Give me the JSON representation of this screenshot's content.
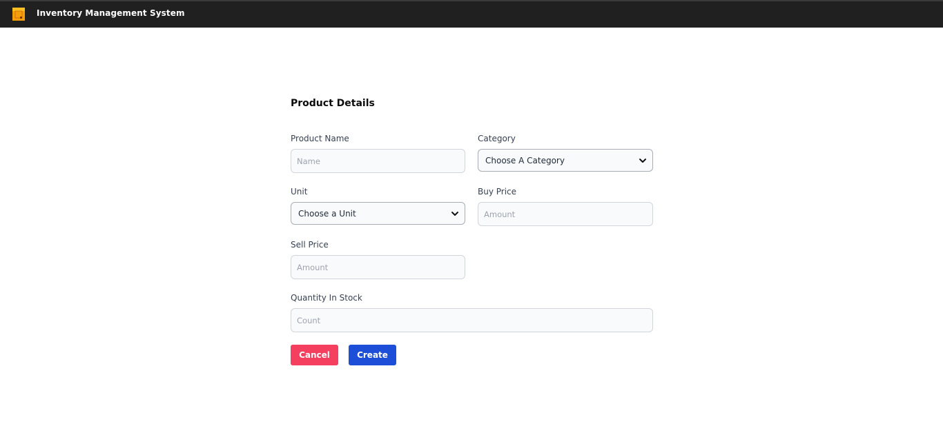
{
  "header": {
    "title": "Inventory Management System",
    "logo_icon": "box-logo-icon",
    "logo_color": "#f59e0b"
  },
  "form": {
    "title": "Product Details",
    "product_name": {
      "label": "Product Name",
      "placeholder": "Name",
      "value": ""
    },
    "category": {
      "label": "Category",
      "selected": "Choose A Category"
    },
    "unit": {
      "label": "Unit",
      "selected": "Choose a Unit"
    },
    "buy_price": {
      "label": "Buy Price",
      "placeholder": "Amount",
      "value": ""
    },
    "sell_price": {
      "label": "Sell Price",
      "placeholder": "Amount",
      "value": ""
    },
    "quantity": {
      "label": "Quantity In Stock",
      "placeholder": "Count",
      "value": ""
    }
  },
  "buttons": {
    "cancel_label": "Cancel",
    "create_label": "Create"
  },
  "colors": {
    "navbar": "#202020",
    "cancel": "#f43f5e",
    "create": "#1d4ed8"
  }
}
